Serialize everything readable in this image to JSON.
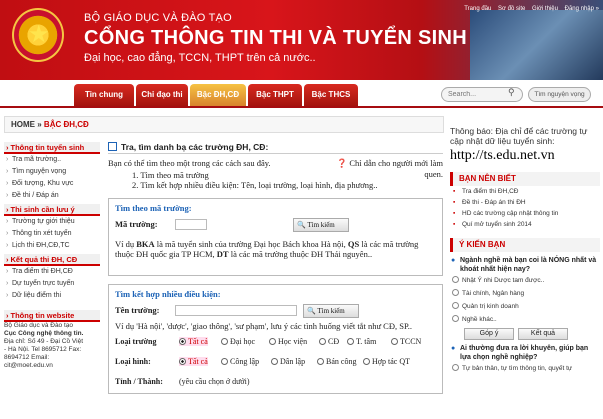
{
  "header": {
    "subtitle": "BỘ GIÁO DỤC VÀ ĐÀO TẠO",
    "title": "CỔNG THÔNG TIN THI VÀ TUYỂN SINH",
    "tagline": "Đại học, cao đẳng, TCCN, THPT trên cả nước..",
    "links": [
      "Trang đầu",
      "Sơ đồ site",
      "Giới thiệu",
      "Đăng nhập »"
    ]
  },
  "nav": {
    "tabs": [
      "Tin chung",
      "Chỉ đạo thi",
      "Bậc ĐH,CĐ",
      "Bậc THPT",
      "Bậc THCS"
    ],
    "active_index": 2,
    "search_placeholder": "Search...",
    "search_teacher_label": "Tìm nguyện vọng"
  },
  "breadcrumb": {
    "home": "HOME",
    "sep": "»",
    "current": "BẬC ĐH,CĐ"
  },
  "sidebar": {
    "sections": [
      {
        "title": "Thông tin tuyển sinh",
        "items": [
          "Tra mã trường..",
          "Tìm nguyện vọng",
          "Đối tượng, Khu vực",
          "Đề thi / Đáp án"
        ]
      },
      {
        "title": "Thi sinh cần lưu ý",
        "items": [
          "Trường tự giới thiệu",
          "Thông tin xét tuyển",
          "Lịch thi ĐH,CĐ,TC"
        ]
      },
      {
        "title": "Kết quả thi ĐH, CĐ",
        "items": [
          "Tra điểm thi ĐH,CĐ",
          "Dự tuyển trực tuyến",
          "Dữ liệu điểm thi"
        ]
      }
    ],
    "website": {
      "title": "Thông tin website",
      "lines": [
        "Bộ Giáo dục và Đào tạo",
        "Cục Công nghệ thông tin.",
        "Địa chỉ: Số 49 - Đại Cồ Việt",
        "- Hà Nội. Tel 8695712 Fax:",
        "8694712 Email:",
        "cit@moet.edu.vn"
      ]
    }
  },
  "main": {
    "title": "Tra, tìm danh bạ các trường ĐH, CĐ:",
    "intro": "Bạn có thể tìm theo một trong các cách sau đây.",
    "guide": "Chỉ dẫn cho người mới làm quen.",
    "steps": [
      "1.  Tìm theo mã trường",
      "2.  Tìm kết hợp nhiều điều kiện: Tên, loại trường, loại hình, địa phương.."
    ],
    "by_code": {
      "heading": "Tìm theo mã trường:",
      "label": "Mã trường:",
      "button": "Tìm kiếm",
      "note_parts": [
        "Ví dụ ",
        "BKA",
        " là mã tuyển sinh của trường Đại học Bách khoa Hà nội, ",
        "QS",
        " là các mã trường thuộc ĐH quốc gia TP HCM, ",
        "DT",
        " là các mã trường thuộc ĐH Thái nguyên.."
      ]
    },
    "combined": {
      "heading": "Tìm kết hợp nhiều điều kiện:",
      "name_label": "Tên trường:",
      "button": "Tìm kiếm",
      "note": "Ví dụ 'Hà nội', 'dược', 'giao thông', 'sư phạm', lưu ý các tình huống viết tắt như CĐ, SP..",
      "type_label": "Loại trường",
      "type_options": [
        "Tất cả",
        "Đại học",
        "Học viện",
        "CĐ",
        "T. tâm",
        "TCCN"
      ],
      "form_label": "Loại hình:",
      "form_options": [
        "Tất cả",
        "Công lập",
        "Dân lập",
        "Bán công",
        "Hợp tác QT"
      ],
      "province_label": "Tỉnh / Thành:",
      "province_note": "(yêu cầu chọn ở dưới)"
    }
  },
  "right": {
    "notice": "Thông báo: Địa chỉ để các trường tự cập nhật dữ liệu tuyển sinh:",
    "url": "http://ts.edu.net.vn",
    "news": {
      "title": "BẠN NÊN BIẾT",
      "items": [
        "Tra điểm thi ĐH,CĐ",
        "Đề thi - Đáp án thi ĐH",
        "HD các trường cập nhật thông tin",
        "Quí mở tuyển sinh 2014"
      ]
    },
    "poll": {
      "title": "Ý KIẾN BẠN",
      "question": "Ngành nghề mà bạn coi là NÓNG nhất và khoát nhất hiện nay?",
      "options": [
        "Nhật Ý nhi Dược tam được..",
        "Tài chính, Ngân hàng",
        "Quản trị kinh doanh",
        "Nghề khác.."
      ],
      "buttons": [
        "Góp ý",
        "Kết quả"
      ],
      "question2": "Ai thường đưa ra lời khuyên, giúp bạn lựa chọn nghề nghiệp?",
      "q2_option": "Tự bản thân, tự tìm thông tin, quyết tự"
    }
  }
}
